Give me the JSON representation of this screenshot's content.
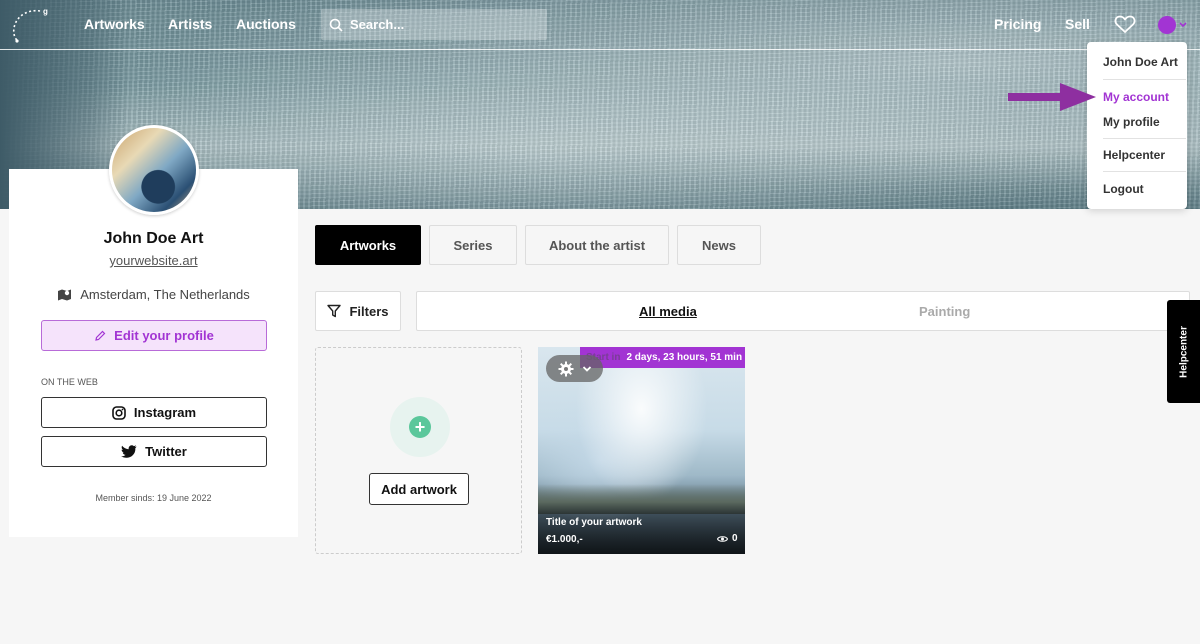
{
  "nav": {
    "links": [
      "Artworks",
      "Artists",
      "Auctions"
    ],
    "search_placeholder": "Search...",
    "right_links": [
      "Pricing",
      "Sell"
    ]
  },
  "account_menu": {
    "name": "John Doe Art",
    "items": [
      "My account",
      "My profile",
      "Helpcenter",
      "Logout"
    ],
    "highlighted": "My account",
    "accent_color": "#a234d3"
  },
  "annotation_arrow_color": "#8e2fa0",
  "profile": {
    "name": "John Doe Art",
    "website": "yourwebsite.art",
    "location": "Amsterdam, The Netherlands",
    "edit_label": "Edit your profile",
    "on_the_web": "ON THE WEB",
    "social": [
      "Instagram",
      "Twitter"
    ],
    "member_since": "Member sinds: 19 June 2022"
  },
  "tabs": {
    "items": [
      "Artworks",
      "Series",
      "About the artist",
      "News"
    ],
    "active": "Artworks"
  },
  "filters": {
    "label": "Filters",
    "media": [
      "All media",
      "Painting"
    ],
    "active_media": "All media"
  },
  "add_artwork": {
    "plus": "+",
    "label": "Add artwork"
  },
  "artwork": {
    "badge_label": "Start in",
    "badge_time": "2 days, 23 hours, 51 min",
    "title": "Title of your artwork",
    "price": "€1.000,-",
    "views": "0"
  },
  "helpcenter_tab": "Helpcenter",
  "icons": [
    "logo-icon",
    "search-icon",
    "heart-icon",
    "user-icon",
    "map-icon",
    "pencil-icon",
    "instagram-icon",
    "twitter-icon",
    "filter-icon",
    "gear-icon",
    "chevron-down-icon",
    "eye-icon",
    "plus-icon"
  ]
}
